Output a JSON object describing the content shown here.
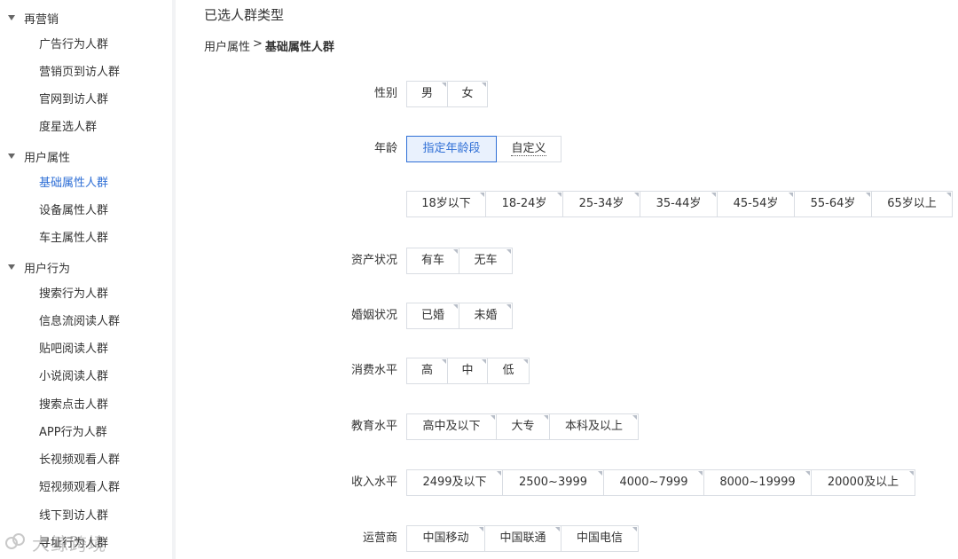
{
  "sidebar": {
    "groups": [
      {
        "label": "再营销",
        "items": [
          "广告行为人群",
          "营销页到访人群",
          "官网到访人群",
          "度星选人群"
        ]
      },
      {
        "label": "用户属性",
        "items": [
          "基础属性人群",
          "设备属性人群",
          "车主属性人群"
        ]
      },
      {
        "label": "用户行为",
        "items": [
          "搜索行为人群",
          "信息流阅读人群",
          "贴吧阅读人群",
          "小说阅读人群",
          "搜索点击人群",
          "APP行为人群",
          "长视频观看人群",
          "短视频观看人群",
          "线下到访人群",
          "寻址行为人群"
        ]
      }
    ],
    "active_item": "基础属性人群"
  },
  "watermark": {
    "text": "大鲸跨境"
  },
  "main": {
    "title": "已选人群类型",
    "breadcrumb": {
      "parent": "用户属性",
      "separator": ">",
      "current": "基础属性人群"
    }
  },
  "rows": {
    "gender": {
      "label": "性别",
      "options": [
        "男",
        "女"
      ]
    },
    "age": {
      "label": "年龄",
      "options": [
        "指定年龄段",
        "自定义"
      ],
      "selected": "指定年龄段"
    },
    "age_ranges": {
      "options": [
        "18岁以下",
        "18-24岁",
        "25-34岁",
        "35-44岁",
        "45-54岁",
        "55-64岁",
        "65岁以上"
      ]
    },
    "assets": {
      "label": "资产状况",
      "options": [
        "有车",
        "无车"
      ]
    },
    "marriage": {
      "label": "婚姻状况",
      "options": [
        "已婚",
        "未婚"
      ]
    },
    "consumption": {
      "label": "消费水平",
      "options": [
        "高",
        "中",
        "低"
      ]
    },
    "education": {
      "label": "教育水平",
      "options": [
        "高中及以下",
        "大专",
        "本科及以上"
      ]
    },
    "income": {
      "label": "收入水平",
      "options": [
        "2499及以下",
        "2500~3999",
        "4000~7999",
        "8000~19999",
        "20000及以上"
      ]
    },
    "carrier": {
      "label": "运营商",
      "options": [
        "中国移动",
        "中国联通",
        "中国电信"
      ]
    }
  },
  "colors": {
    "accent": "#2f6fd6",
    "selected_bg": "#e9f1fd",
    "border": "#d9dde3"
  }
}
